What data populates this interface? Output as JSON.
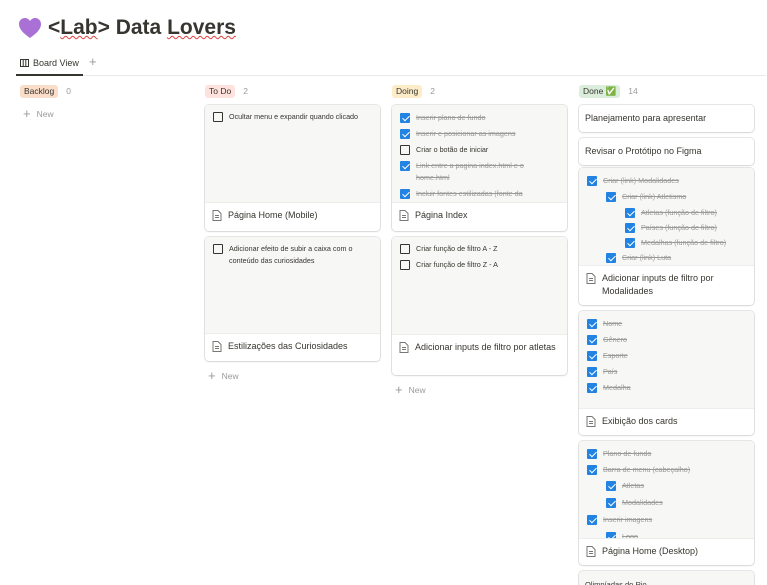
{
  "page": {
    "title_prefix": "<",
    "title_word1": "Lab",
    "title_mid": "> Data ",
    "title_word2": "Lovers"
  },
  "views": {
    "active_label": "Board View",
    "add_label": "+"
  },
  "new_label": "New",
  "columns": [
    {
      "name": "Backlog",
      "count": "0",
      "color": "#fadec9"
    },
    {
      "name": "To Do",
      "count": "2",
      "color": "#ffe2dd"
    },
    {
      "name": "Doing",
      "count": "2",
      "color": "#fdecc8"
    },
    {
      "name": "Done ✅",
      "count": "14",
      "color": "#dbeddb"
    }
  ],
  "todo": {
    "card1": {
      "items": [
        {
          "text": "Ocultar menu e expandir quando clicado",
          "done": false
        }
      ],
      "title": "Página Home (Mobile)"
    },
    "card2": {
      "items": [
        {
          "text": "Adicionar efeito de subir a caixa com o conteúdo das curiosidades",
          "done": false
        }
      ],
      "title": "Estilizações das Curiosidades"
    }
  },
  "doing": {
    "card1": {
      "items": [
        {
          "text": "Inserir plano de fundo",
          "done": true
        },
        {
          "text": "Inserir e posicionar as imagens",
          "done": true
        },
        {
          "text": "Criar o botão de iniciar",
          "done": false
        },
        {
          "text": "Link entre a pagina index.html e o home.html",
          "done": true
        },
        {
          "text": "Incluir fontes estilizadas (fonte da",
          "done": true
        }
      ],
      "title": "Página Index"
    },
    "card2": {
      "items": [
        {
          "text": "Criar função de filtro A - Z",
          "done": false
        },
        {
          "text": "Criar função de filtro Z - A",
          "done": false
        }
      ],
      "title": "Adicionar inputs de filtro por atletas"
    }
  },
  "done": {
    "plain1": "Planejamento para apresentar",
    "plain2": "Revisar o Protótipo no Figma",
    "card3": {
      "items": [
        {
          "text": "Criar (link) Modalidades",
          "done": true,
          "level": 0
        },
        {
          "text": "Criar (link) Atletismo",
          "done": true,
          "level": 1
        },
        {
          "text": "Atletas (função de filtro)",
          "done": true,
          "level": 2
        },
        {
          "text": "Países (função de filtro)",
          "done": true,
          "level": 2
        },
        {
          "text": "Medalhas (função de filtro)",
          "done": true,
          "level": 2
        },
        {
          "text": "Criar (link) Luta",
          "done": true,
          "level": 1
        }
      ],
      "title": "Adicionar inputs de filtro por Modalidades"
    },
    "card4": {
      "items": [
        {
          "text": "Nome",
          "done": true
        },
        {
          "text": "Gênero",
          "done": true
        },
        {
          "text": "Esporte",
          "done": true
        },
        {
          "text": "País",
          "done": true
        },
        {
          "text": "Medalha",
          "done": true
        }
      ],
      "title": "Exibição dos cards"
    },
    "card5": {
      "items": [
        {
          "text": "Plano de fundo",
          "done": true,
          "level": 0
        },
        {
          "text": "Barra de menu (cabeçalho)",
          "done": true,
          "level": 0
        },
        {
          "text": "Atletas",
          "done": true,
          "level": 1
        },
        {
          "text": "Modalidades",
          "done": true,
          "level": 1
        },
        {
          "text": "Inserir imagens",
          "done": true,
          "level": 0
        },
        {
          "text": "Logo",
          "done": true,
          "level": 1
        }
      ],
      "title": "Página Home (Desktop)"
    },
    "card6_title": "Olimpíadas do Rio"
  }
}
